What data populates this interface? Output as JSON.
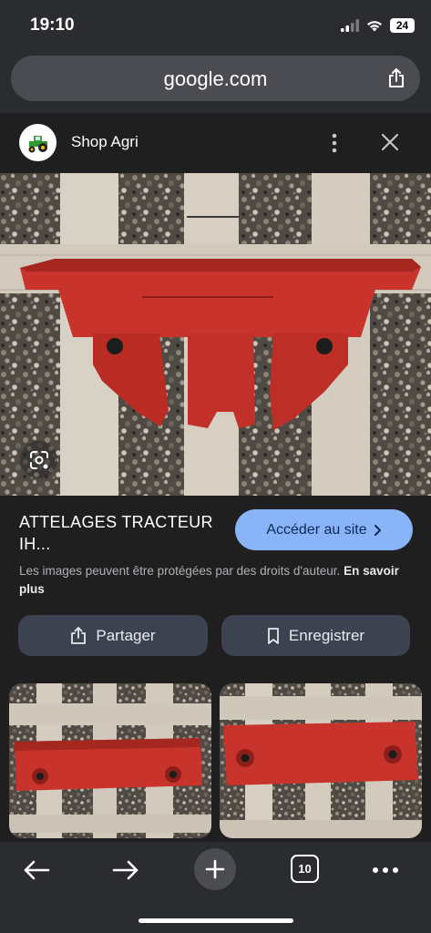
{
  "status": {
    "time": "19:10",
    "battery": "24"
  },
  "browser": {
    "url": "google.com",
    "tab_count": "10"
  },
  "source": {
    "name": "Shop Agri"
  },
  "result": {
    "title": "ATTELAGES TRACTEUR IH...",
    "visit_label": "Accéder au site",
    "copyright_text": "Les images peuvent être protégées par des droits d'auteur.",
    "learn_more": "En savoir plus",
    "share_label": "Partager",
    "save_label": "Enregistrer"
  },
  "icons": {
    "signal": "signal-icon",
    "wifi": "wifi-icon",
    "share": "share-icon",
    "tractor": "tractor-logo",
    "more": "more-vertical-icon",
    "close": "close-icon",
    "lens": "google-lens-icon",
    "chevron": "chevron-right-icon",
    "bookmark": "bookmark-icon",
    "back": "back-arrow-icon",
    "forward": "forward-arrow-icon",
    "new_tab": "plus-icon",
    "menu": "more-horizontal-icon"
  },
  "colors": {
    "accent": "#8ab4f8",
    "panel": "#2b2c2f",
    "background": "#1f1f1f",
    "button": "#3c4250",
    "part_red": "#c8332b"
  }
}
